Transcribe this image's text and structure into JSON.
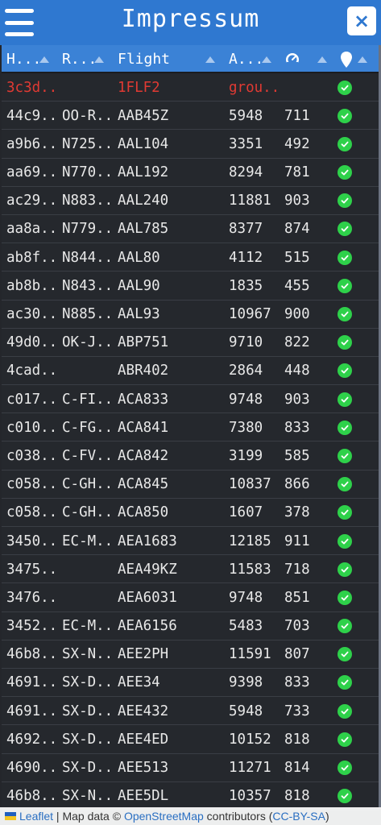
{
  "header": {
    "title": "Impressum",
    "close_label": "×"
  },
  "columns": [
    {
      "key": "hex",
      "label": "H..."
    },
    {
      "key": "reg",
      "label": "R..."
    },
    {
      "key": "flight",
      "label": "Flight"
    },
    {
      "key": "alt",
      "label": "A..."
    },
    {
      "key": "speed",
      "label": ""
    },
    {
      "key": "pos",
      "label": ""
    }
  ],
  "rows": [
    {
      "hex": "3c3d...",
      "reg": "",
      "flight": "1FLF2",
      "alt": "grou...",
      "speed": "",
      "alert": true
    },
    {
      "hex": "44c9...",
      "reg": "OO-R...",
      "flight": "AAB45Z",
      "alt": "5948",
      "speed": "711"
    },
    {
      "hex": "a9b6...",
      "reg": "N725...",
      "flight": "AAL104",
      "alt": "3351",
      "speed": "492"
    },
    {
      "hex": "aa69...",
      "reg": "N770...",
      "flight": "AAL192",
      "alt": "8294",
      "speed": "781"
    },
    {
      "hex": "ac29...",
      "reg": "N883...",
      "flight": "AAL240",
      "alt": "11881",
      "speed": "903"
    },
    {
      "hex": "aa8a...",
      "reg": "N779...",
      "flight": "AAL785",
      "alt": "8377",
      "speed": "874"
    },
    {
      "hex": "ab8f...",
      "reg": "N844...",
      "flight": "AAL80",
      "alt": "4112",
      "speed": "515"
    },
    {
      "hex": "ab8b...",
      "reg": "N843...",
      "flight": "AAL90",
      "alt": "1835",
      "speed": "455"
    },
    {
      "hex": "ac30...",
      "reg": "N885...",
      "flight": "AAL93",
      "alt": "10967",
      "speed": "900"
    },
    {
      "hex": "49d0...",
      "reg": "OK-J...",
      "flight": "ABP751",
      "alt": "9710",
      "speed": "822"
    },
    {
      "hex": "4cad...",
      "reg": "",
      "flight": "ABR402",
      "alt": "2864",
      "speed": "448"
    },
    {
      "hex": "c017...",
      "reg": "C-FI...",
      "flight": "ACA833",
      "alt": "9748",
      "speed": "903"
    },
    {
      "hex": "c010...",
      "reg": "C-FG...",
      "flight": "ACA841",
      "alt": "7380",
      "speed": "833"
    },
    {
      "hex": "c038...",
      "reg": "C-FV...",
      "flight": "ACA842",
      "alt": "3199",
      "speed": "585"
    },
    {
      "hex": "c058...",
      "reg": "C-GH...",
      "flight": "ACA845",
      "alt": "10837",
      "speed": "866"
    },
    {
      "hex": "c058...",
      "reg": "C-GH...",
      "flight": "ACA850",
      "alt": "1607",
      "speed": "378"
    },
    {
      "hex": "3450...",
      "reg": "EC-M...",
      "flight": "AEA1683",
      "alt": "12185",
      "speed": "911"
    },
    {
      "hex": "3475...",
      "reg": "",
      "flight": "AEA49KZ",
      "alt": "11583",
      "speed": "718"
    },
    {
      "hex": "3476...",
      "reg": "",
      "flight": "AEA6031",
      "alt": "9748",
      "speed": "851"
    },
    {
      "hex": "3452...",
      "reg": "EC-M...",
      "flight": "AEA6156",
      "alt": "5483",
      "speed": "703"
    },
    {
      "hex": "46b8...",
      "reg": "SX-N...",
      "flight": "AEE2PH",
      "alt": "11591",
      "speed": "807"
    },
    {
      "hex": "4691...",
      "reg": "SX-D...",
      "flight": "AEE34",
      "alt": "9398",
      "speed": "833"
    },
    {
      "hex": "4691...",
      "reg": "SX-D...",
      "flight": "AEE432",
      "alt": "5948",
      "speed": "733"
    },
    {
      "hex": "4692...",
      "reg": "SX-D...",
      "flight": "AEE4ED",
      "alt": "10152",
      "speed": "818"
    },
    {
      "hex": "4690...",
      "reg": "SX-D...",
      "flight": "AEE513",
      "alt": "11271",
      "speed": "814"
    },
    {
      "hex": "46b8...",
      "reg": "SX-N...",
      "flight": "AEE5DL",
      "alt": "10357",
      "speed": "818"
    }
  ],
  "attribution": {
    "leaflet": "Leaflet",
    "separator": " | Map data © ",
    "osm": "OpenStreetMap",
    "contributors": " contributors (",
    "license": "CC-BY-SA",
    "close_paren": ")"
  },
  "colors": {
    "header": "#2f78d0",
    "table_header": "#3b82d6",
    "alert": "#e03a33",
    "check": "#2ed14a",
    "row_bg": "#25282d"
  },
  "icons": {
    "menu": "hamburger-icon",
    "close": "close-icon",
    "speed": "speedometer-icon",
    "position": "map-pin-icon",
    "status": "check-circle-icon",
    "sort": "sort-triangle-icon"
  }
}
